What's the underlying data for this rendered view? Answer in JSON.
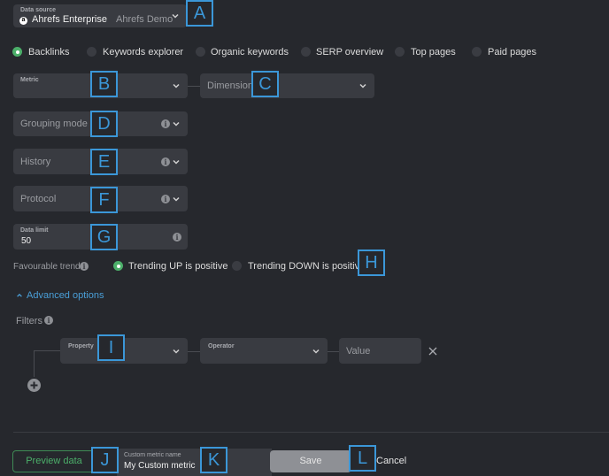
{
  "data_source": {
    "label": "Data source",
    "account": "Ahrefs Enterprise",
    "project": "Ahrefs Demo",
    "logo": "a"
  },
  "source_tabs": [
    {
      "label": "Backlinks",
      "selected": true
    },
    {
      "label": "Keywords explorer",
      "selected": false
    },
    {
      "label": "Organic keywords",
      "selected": false
    },
    {
      "label": "SERP overview",
      "selected": false
    },
    {
      "label": "Top pages",
      "selected": false
    },
    {
      "label": "Paid pages",
      "selected": false
    }
  ],
  "metric": {
    "label": "Metric"
  },
  "dimension": {
    "placeholder": "Dimension"
  },
  "grouping_mode": {
    "placeholder": "Grouping mode"
  },
  "history": {
    "placeholder": "History"
  },
  "protocol": {
    "placeholder": "Protocol"
  },
  "data_limit": {
    "label": "Data limit",
    "value": "50"
  },
  "favourable_trend": {
    "label": "Favourable trend",
    "options": [
      {
        "label": "Trending UP is positive",
        "selected": true
      },
      {
        "label": "Trending DOWN is positive",
        "selected": false
      }
    ]
  },
  "advanced_options": {
    "label": "Advanced options"
  },
  "filters": {
    "label": "Filters",
    "property_label": "Property",
    "operator_label": "Operator",
    "value_placeholder": "Value"
  },
  "footer": {
    "preview_label": "Preview data",
    "name_label": "Custom metric name",
    "name_value": "My Custom metric",
    "save_label": "Save",
    "cancel_label": "Cancel"
  },
  "annotations": [
    "A",
    "B",
    "C",
    "D",
    "E",
    "F",
    "G",
    "H",
    "I",
    "J",
    "K",
    "L"
  ],
  "colors": {
    "accent_green": "#4caf6a",
    "link_blue": "#4a9fd8",
    "annotation_blue": "#3b97d8",
    "background": "#26282d",
    "field": "#393b41"
  }
}
